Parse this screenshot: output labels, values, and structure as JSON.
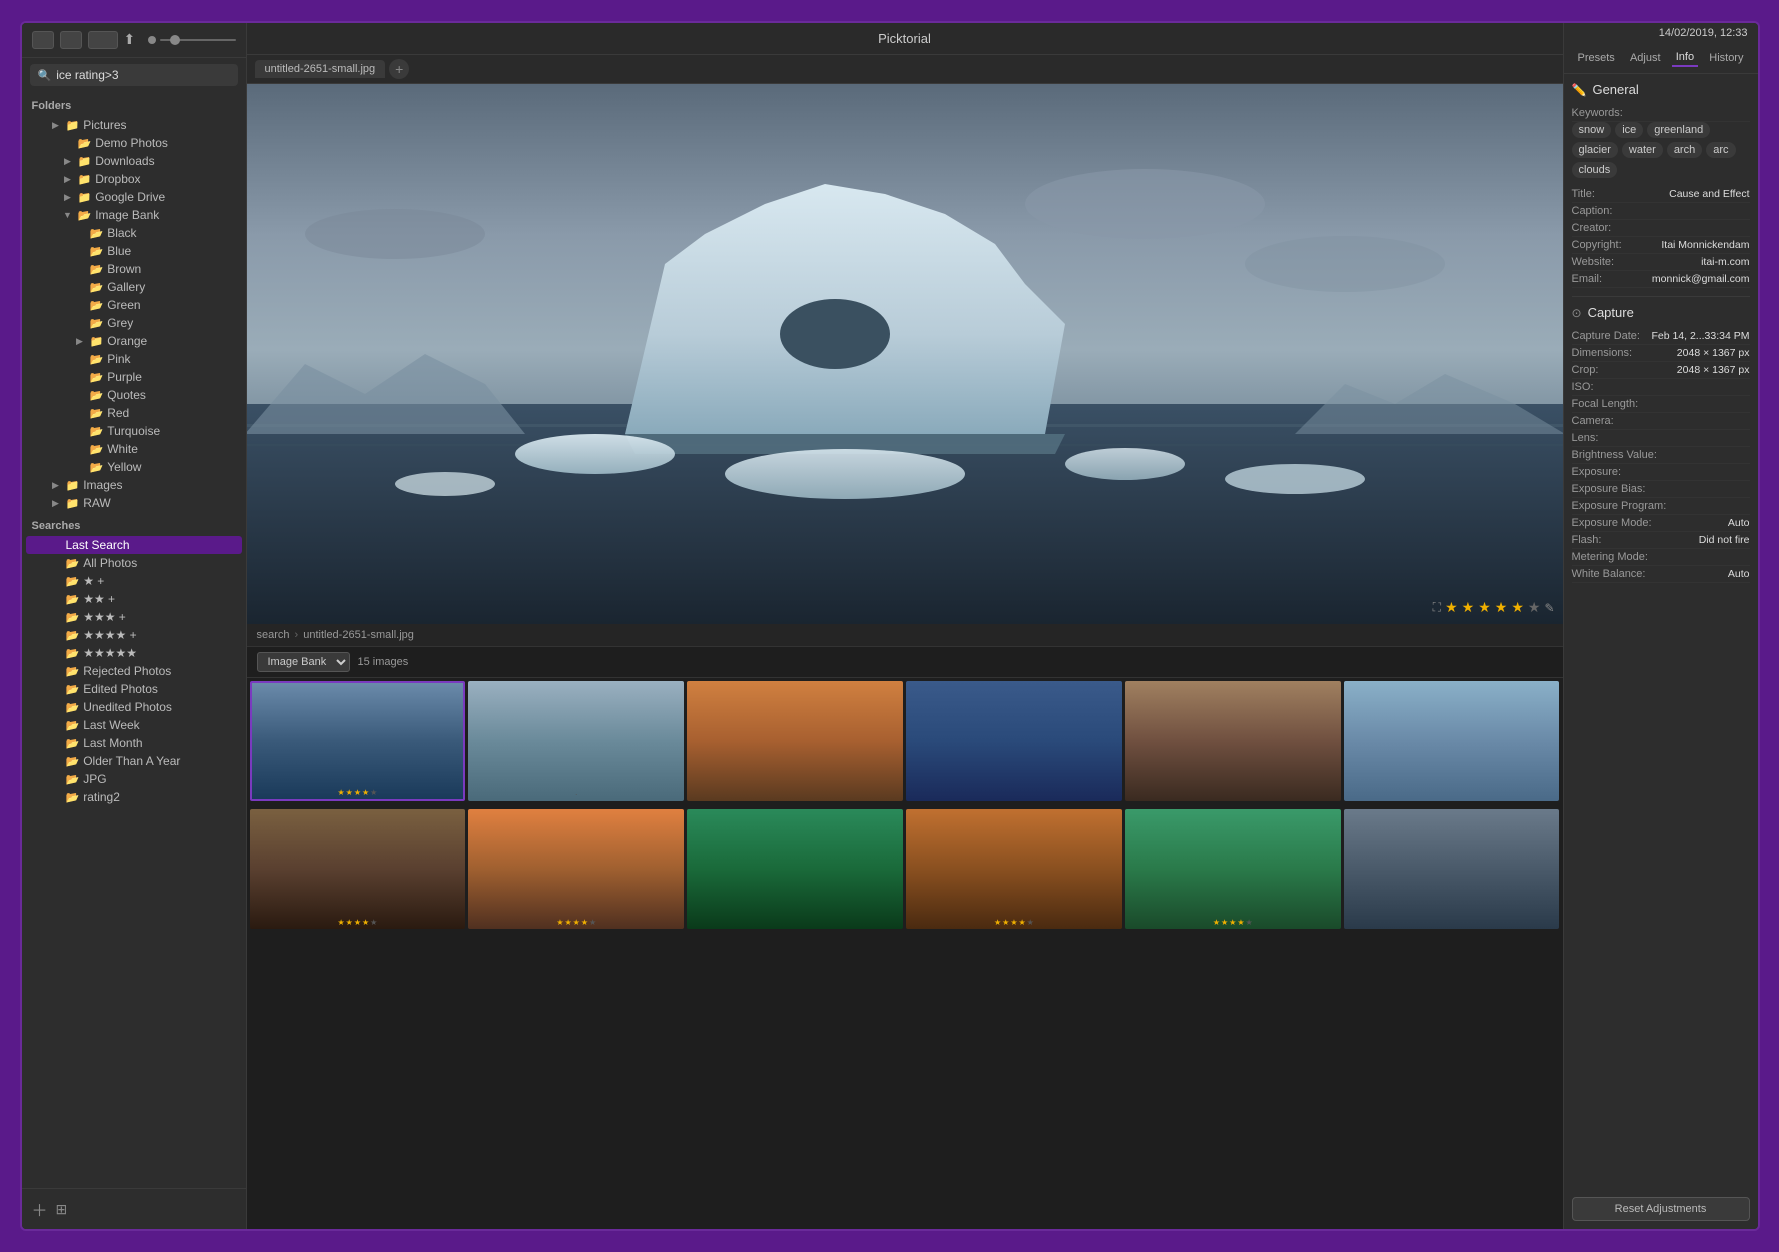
{
  "app": {
    "title": "Picktorial",
    "datetime": "14/02/2019, 12:33"
  },
  "sidebar": {
    "search_placeholder": "ice rating>3",
    "search_value": "ice rating>3",
    "folders_label": "Folders",
    "folders": [
      {
        "id": "pictures",
        "label": "Pictures",
        "indent": 1,
        "type": "closed"
      },
      {
        "id": "demo-photos",
        "label": "Demo Photos",
        "indent": 2,
        "type": "leaf"
      },
      {
        "id": "downloads",
        "label": "Downloads",
        "indent": 2,
        "type": "closed"
      },
      {
        "id": "dropbox",
        "label": "Dropbox",
        "indent": 2,
        "type": "closed"
      },
      {
        "id": "google-drive",
        "label": "Google Drive",
        "indent": 2,
        "type": "closed"
      },
      {
        "id": "image-bank",
        "label": "Image Bank",
        "indent": 2,
        "type": "open"
      },
      {
        "id": "black",
        "label": "Black",
        "indent": 3,
        "type": "leaf"
      },
      {
        "id": "blue",
        "label": "Blue",
        "indent": 3,
        "type": "leaf"
      },
      {
        "id": "brown",
        "label": "Brown",
        "indent": 3,
        "type": "leaf"
      },
      {
        "id": "gallery",
        "label": "Gallery",
        "indent": 3,
        "type": "leaf"
      },
      {
        "id": "green",
        "label": "Green",
        "indent": 3,
        "type": "leaf"
      },
      {
        "id": "grey",
        "label": "Grey",
        "indent": 3,
        "type": "leaf"
      },
      {
        "id": "orange",
        "label": "Orange",
        "indent": 3,
        "type": "closed"
      },
      {
        "id": "pink",
        "label": "Pink",
        "indent": 3,
        "type": "leaf"
      },
      {
        "id": "purple",
        "label": "Purple",
        "indent": 3,
        "type": "leaf"
      },
      {
        "id": "quotes",
        "label": "Quotes",
        "indent": 3,
        "type": "leaf"
      },
      {
        "id": "red",
        "label": "Red",
        "indent": 3,
        "type": "leaf"
      },
      {
        "id": "turquoise",
        "label": "Turquoise",
        "indent": 3,
        "type": "leaf"
      },
      {
        "id": "white",
        "label": "White",
        "indent": 3,
        "type": "leaf"
      },
      {
        "id": "yellow",
        "label": "Yellow",
        "indent": 3,
        "type": "leaf"
      },
      {
        "id": "images",
        "label": "Images",
        "indent": 1,
        "type": "closed"
      },
      {
        "id": "raw",
        "label": "RAW",
        "indent": 1,
        "type": "closed"
      }
    ],
    "searches_label": "Searches",
    "searches": [
      {
        "id": "last-search",
        "label": "Last Search",
        "indent": 1,
        "type": "selected"
      },
      {
        "id": "all-photos",
        "label": "All Photos",
        "indent": 1,
        "type": "leaf"
      },
      {
        "id": "2star",
        "label": "★ +",
        "indent": 1,
        "type": "leaf"
      },
      {
        "id": "3star",
        "label": "★★ +",
        "indent": 1,
        "type": "leaf"
      },
      {
        "id": "4star",
        "label": "★★★ +",
        "indent": 1,
        "type": "leaf"
      },
      {
        "id": "5star",
        "label": "★★★★ +",
        "indent": 1,
        "type": "leaf"
      },
      {
        "id": "5star-only",
        "label": "★★★★★",
        "indent": 1,
        "type": "leaf"
      },
      {
        "id": "rejected-photos",
        "label": "Rejected Photos",
        "indent": 1,
        "type": "leaf"
      },
      {
        "id": "edited-photos",
        "label": "Edited Photos",
        "indent": 1,
        "type": "leaf"
      },
      {
        "id": "unedited-photos",
        "label": "Unedited Photos",
        "indent": 1,
        "type": "leaf"
      },
      {
        "id": "last-week",
        "label": "Last Week",
        "indent": 1,
        "type": "leaf"
      },
      {
        "id": "last-month",
        "label": "Last Month",
        "indent": 1,
        "type": "leaf"
      },
      {
        "id": "older-than-year",
        "label": "Older Than A Year",
        "indent": 1,
        "type": "leaf"
      },
      {
        "id": "jpg",
        "label": "JPG",
        "indent": 1,
        "type": "leaf"
      },
      {
        "id": "rating2",
        "label": "rating2",
        "indent": 1,
        "type": "leaf"
      }
    ]
  },
  "main": {
    "title": "Picktorial",
    "tab": "untitled-2651-small.jpg",
    "breadcrumb": [
      "search",
      "untitled-2651-small.jpg"
    ],
    "image_bank_label": "Image Bank",
    "image_count": "15 images",
    "rating_stars": [
      true,
      true,
      true,
      true,
      true,
      false
    ],
    "thumbnails": [
      {
        "id": 1,
        "style": "thumb-1",
        "selected": true,
        "stars": [
          true,
          true,
          true,
          true,
          false
        ]
      },
      {
        "id": 2,
        "style": "thumb-2",
        "selected": false,
        "stars": []
      },
      {
        "id": 3,
        "style": "thumb-3",
        "selected": false,
        "stars": []
      },
      {
        "id": 4,
        "style": "thumb-4",
        "selected": false,
        "stars": []
      },
      {
        "id": 5,
        "style": "thumb-5",
        "selected": false,
        "stars": []
      },
      {
        "id": 6,
        "style": "thumb-6",
        "selected": false,
        "stars": []
      },
      {
        "id": 7,
        "style": "thumb-7",
        "selected": false,
        "stars": []
      },
      {
        "id": 8,
        "style": "thumb-8",
        "selected": false,
        "stars": []
      },
      {
        "id": 9,
        "style": "thumb-9",
        "selected": false,
        "stars": []
      },
      {
        "id": 10,
        "style": "thumb-10",
        "selected": false,
        "stars": []
      },
      {
        "id": 11,
        "style": "thumb-11",
        "selected": false,
        "stars": []
      },
      {
        "id": 12,
        "style": "thumb-12",
        "selected": false,
        "stars": []
      }
    ]
  },
  "right_panel": {
    "tabs": [
      "Presets",
      "Adjust",
      "Info",
      "History"
    ],
    "active_tab": "Info",
    "general_label": "General",
    "keywords_label": "Keywords:",
    "keywords": [
      "snow",
      "ice",
      "greenland",
      "glacier",
      "water",
      "arch",
      "arc",
      "clouds"
    ],
    "title_label": "Title:",
    "title_value": "Cause and  Effect",
    "caption_label": "Caption:",
    "caption_value": "",
    "creator_label": "Creator:",
    "creator_value": "",
    "copyright_label": "Copyright:",
    "copyright_value": "Itai Monnickendam",
    "website_label": "Website:",
    "website_value": "itai-m.com",
    "email_label": "Email:",
    "email_value": "monnick@gmail.com",
    "capture_label": "Capture",
    "capture_date_label": "Capture Date:",
    "capture_date_value": "Feb 14, 2...33:34 PM",
    "dimensions_label": "Dimensions:",
    "dimensions_value": "2048 × 1367 px",
    "crop_label": "Crop:",
    "crop_value": "2048 × 1367 px",
    "iso_label": "ISO:",
    "iso_value": "",
    "focal_length_label": "Focal Length:",
    "focal_length_value": "",
    "camera_label": "Camera:",
    "camera_value": "",
    "lens_label": "Lens:",
    "lens_value": "",
    "brightness_label": "Brightness Value:",
    "brightness_value": "",
    "exposure_label": "Exposure:",
    "exposure_value": "",
    "exposure_bias_label": "Exposure Bias:",
    "exposure_bias_value": "",
    "exposure_program_label": "Exposure Program:",
    "exposure_program_value": "",
    "exposure_mode_label": "Exposure Mode:",
    "exposure_mode_value": "Auto",
    "flash_label": "Flash:",
    "flash_value": "Did not fire",
    "metering_label": "Metering Mode:",
    "metering_value": "",
    "white_balance_label": "White Balance:",
    "white_balance_value": "Auto",
    "reset_btn_label": "Reset Adjustments"
  }
}
